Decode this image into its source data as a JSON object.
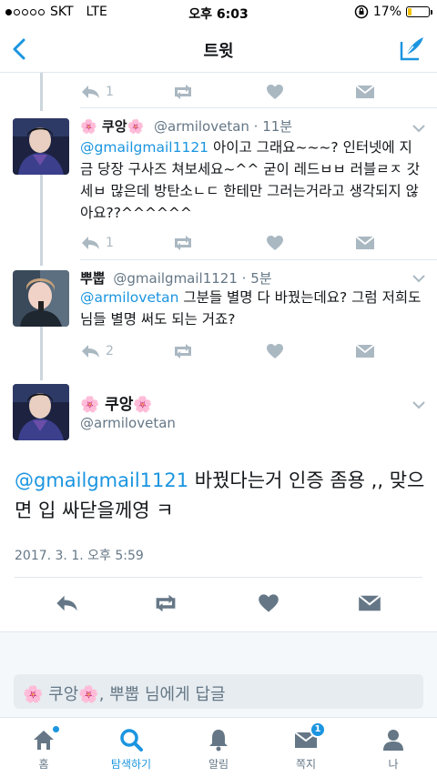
{
  "status_bar": {
    "carrier": "SKT",
    "network": "LTE",
    "time": "오후 6:03",
    "battery_percent": "17%",
    "battery_level": 0.17,
    "signal_bars_filled": 1,
    "signal_bars_total": 5
  },
  "nav": {
    "title": "트윗",
    "back_icon": "chevron-left-icon",
    "compose_icon": "compose-feather-icon"
  },
  "colors": {
    "accent": "#1b95e0",
    "action_gray": "#aab8c2",
    "handle_gray": "#657786"
  },
  "top_actions": {
    "reply_count": "1"
  },
  "tweets": [
    {
      "name_emoji_left": "🌸",
      "name": "쿠앙",
      "name_emoji_right": "🌸",
      "handle": "@armilovetan",
      "time": "11분",
      "mention": "@gmailgmail1121",
      "text_after_mention": " 아이고 그래요~~~? 인터넷에 지금 당장 구사즈 쳐보세요~^^ 굳이 레드ㅂㅂ 러블ㄹㅈ 갓세ㅂ 많은데 방탄소ㄴㄷ 한테만 그러는거라고 생각되지 않아요??^^^^^^",
      "reply_count": "1"
    },
    {
      "name": "뿌뿝",
      "handle": "@gmailgmail1121",
      "time": "5분",
      "mention": "@armilovetan",
      "text_after_mention": " 그분들 별명 다 바꿨는데요? 그럼 저희도 님들 별명 써도 되는 거죠?",
      "reply_count": "2"
    }
  ],
  "main_tweet": {
    "name_emoji_left": "🌸",
    "name": "쿠앙",
    "name_emoji_right": "🌸",
    "handle": "@armilovetan",
    "mention": "@gmailgmail1121",
    "text_after_mention": " 바꿨다는거 인증 좀용 ,, 맞으면 입 싸닫을께영 ㅋ",
    "timestamp": "2017. 3. 1. 오후 5:59"
  },
  "reply_box": {
    "emoji_left": "🌸",
    "name": "쿠앙",
    "emoji_right": "🌸",
    "suffix": ", 뿌뿝 님에게 답글"
  },
  "tab_bar": {
    "tabs": [
      {
        "label": "홈",
        "icon": "home-icon"
      },
      {
        "label": "탐색하기",
        "icon": "search-icon"
      },
      {
        "label": "알림",
        "icon": "bell-icon"
      },
      {
        "label": "쪽지",
        "icon": "envelope-icon",
        "badge": "1"
      },
      {
        "label": "나",
        "icon": "profile-icon"
      }
    ]
  }
}
